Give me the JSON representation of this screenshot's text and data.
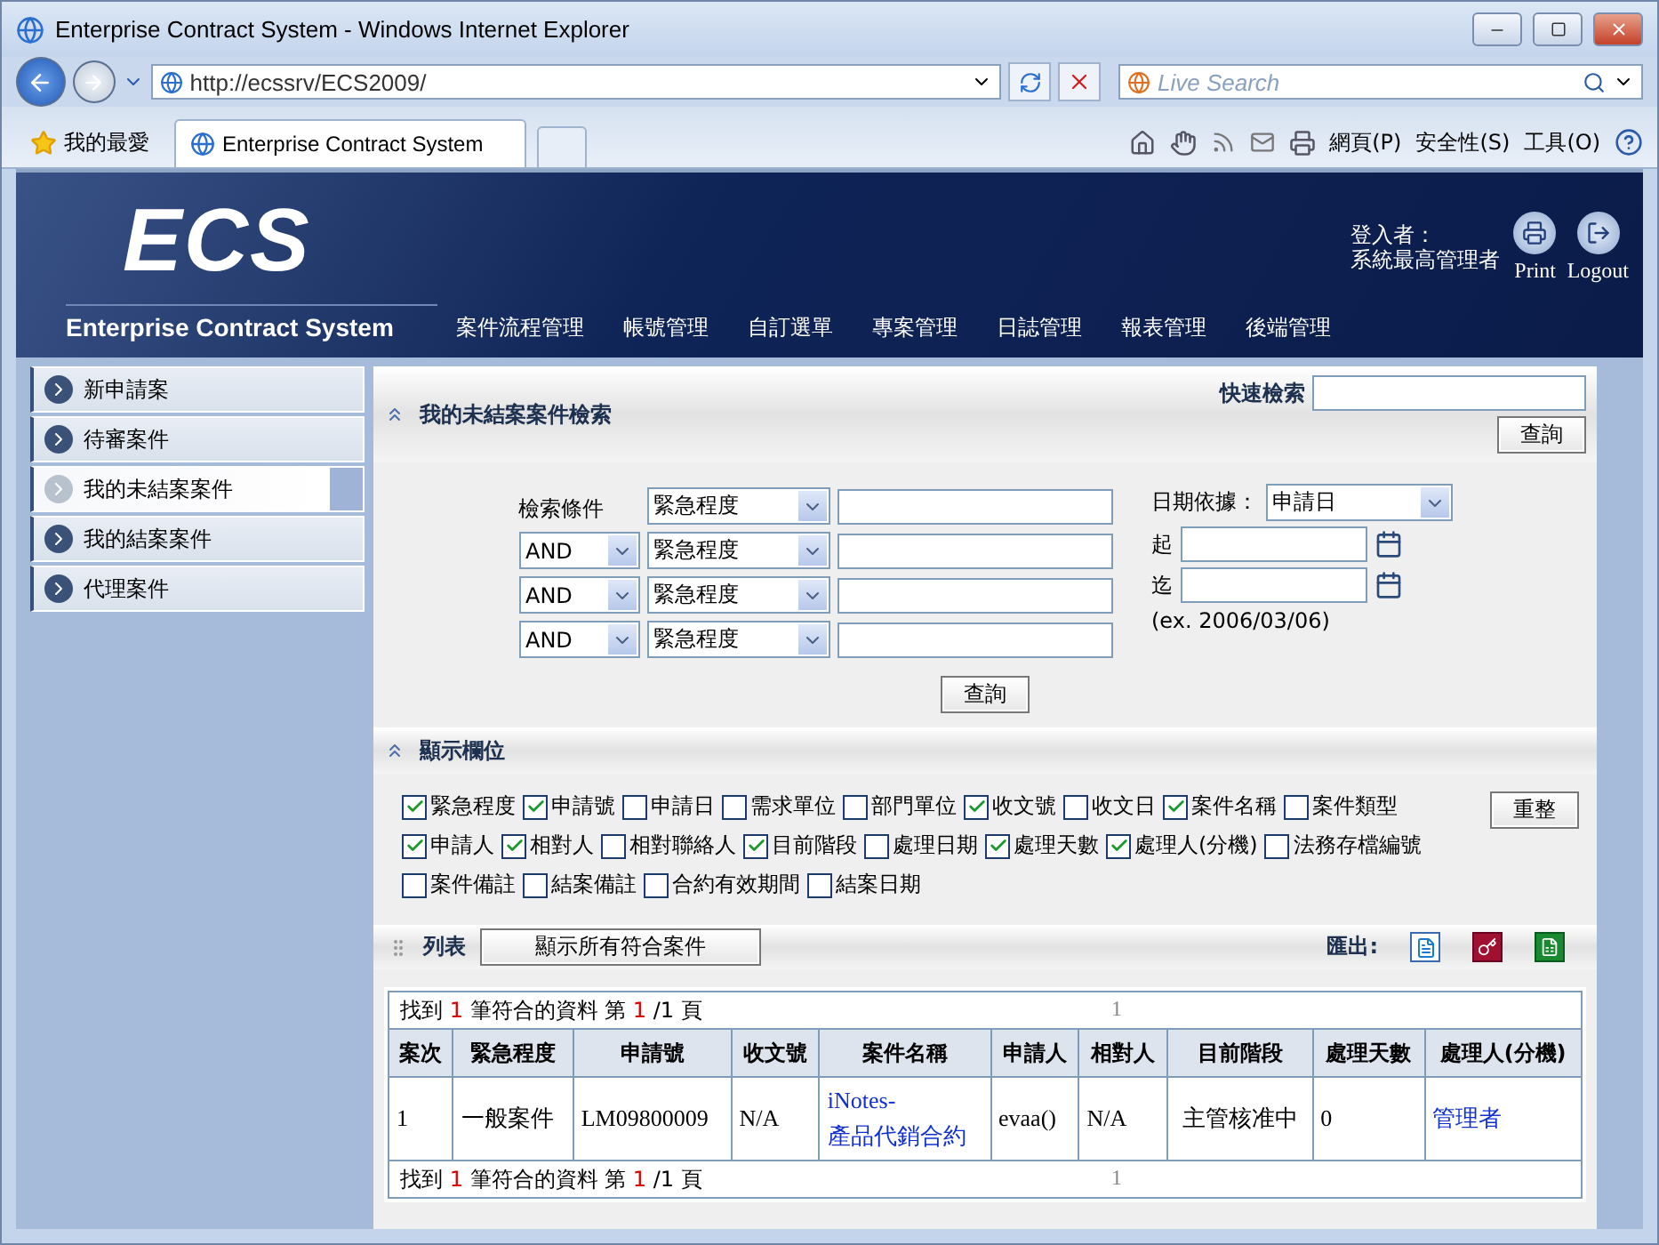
{
  "window": {
    "title": "Enterprise Contract System - Windows Internet Explorer"
  },
  "browser": {
    "address": "http://ecssrv/ECS2009/",
    "search_placeholder": "Live Search",
    "favorites": "我的最愛",
    "tab": "Enterprise Contract System",
    "menus": [
      "網頁(P)",
      "安全性(S)",
      "工具(O)"
    ]
  },
  "header": {
    "logo": "ECS",
    "subtitle": "Enterprise Contract System",
    "nav": [
      "案件流程管理",
      "帳號管理",
      "自訂選單",
      "專案管理",
      "日誌管理",
      "報表管理",
      "後端管理"
    ],
    "login_label": "登入者：",
    "user": "系統最高管理者",
    "actions": [
      {
        "kind": "print",
        "label": "Print"
      },
      {
        "kind": "logout",
        "label": "Logout"
      }
    ]
  },
  "sidebar": {
    "items": [
      {
        "label": "新申請案",
        "selected": false
      },
      {
        "label": "待審案件",
        "selected": false
      },
      {
        "label": "我的未結案案件",
        "selected": true
      },
      {
        "label": "我的結案案件",
        "selected": false
      },
      {
        "label": "代理案件",
        "selected": false
      }
    ]
  },
  "search": {
    "title": "我的未結案案件檢索",
    "quick_label": "快速檢索",
    "quick_button": "查詢",
    "criteria_label": "檢索條件",
    "rows": [
      {
        "field": "緊急程度"
      },
      {
        "operator": "AND",
        "field": "緊急程度"
      },
      {
        "operator": "AND",
        "field": "緊急程度"
      },
      {
        "operator": "AND",
        "field": "緊急程度"
      }
    ],
    "date_basis_label": "日期依據：",
    "date_basis": "申請日",
    "from_label": "起",
    "to_label": "迄",
    "date_hint": "(ex. 2006/03/06)",
    "submit": "查詢"
  },
  "columns": {
    "title": "顯示欄位",
    "reset": "重整",
    "options": [
      {
        "label": "緊急程度",
        "checked": true
      },
      {
        "label": "申請號",
        "checked": true
      },
      {
        "label": "申請日",
        "checked": false
      },
      {
        "label": "需求單位",
        "checked": false
      },
      {
        "label": "部門單位",
        "checked": false
      },
      {
        "label": "收文號",
        "checked": true
      },
      {
        "label": "收文日",
        "checked": false
      },
      {
        "label": "案件名稱",
        "checked": true
      },
      {
        "label": "案件類型",
        "checked": false
      },
      {
        "label": "申請人",
        "checked": true
      },
      {
        "label": "相對人",
        "checked": true
      },
      {
        "label": "相對聯絡人",
        "checked": false
      },
      {
        "label": "目前階段",
        "checked": true
      },
      {
        "label": "處理日期",
        "checked": false
      },
      {
        "label": "處理天數",
        "checked": true
      },
      {
        "label": "處理人(分機)",
        "checked": true
      },
      {
        "label": "法務存檔編號",
        "checked": false
      },
      {
        "label": "案件備註",
        "checked": false
      },
      {
        "label": "結案備註",
        "checked": false
      },
      {
        "label": "合約有效期間",
        "checked": false
      },
      {
        "label": "結案日期",
        "checked": false
      }
    ]
  },
  "list": {
    "title": "列表",
    "show_all": "顯示所有符合案件",
    "export_label": "匯出:",
    "summary_top": {
      "before": "找到 ",
      "count": "1",
      "middle": " 筆符合的資料 第 ",
      "page": "1",
      "after": " /1 頁",
      "pager": "1"
    },
    "summary_bottom": {
      "before": "找到 ",
      "count": "1",
      "middle": " 筆符合的資料 第 ",
      "page": "1",
      "after": " /1 頁",
      "pager": "1"
    },
    "table": {
      "columns": [
        "案次",
        "緊急程度",
        "申請號",
        "收文號",
        "案件名稱",
        "申請人",
        "相對人",
        "目前階段",
        "處理天數",
        "處理人(分機)"
      ],
      "rows": [
        {
          "cells": [
            {
              "text": "1"
            },
            {
              "text": "一般案件"
            },
            {
              "text": "LM09800009"
            },
            {
              "text": "N/A"
            },
            {
              "text": "iNotes-\n產品代銷合約",
              "kind": "link"
            },
            {
              "text": "evaa()"
            },
            {
              "text": "N/A"
            },
            {
              "text": "主管核准中"
            },
            {
              "text": "0"
            },
            {
              "text": "管理者",
              "kind": "link"
            }
          ]
        }
      ]
    }
  }
}
